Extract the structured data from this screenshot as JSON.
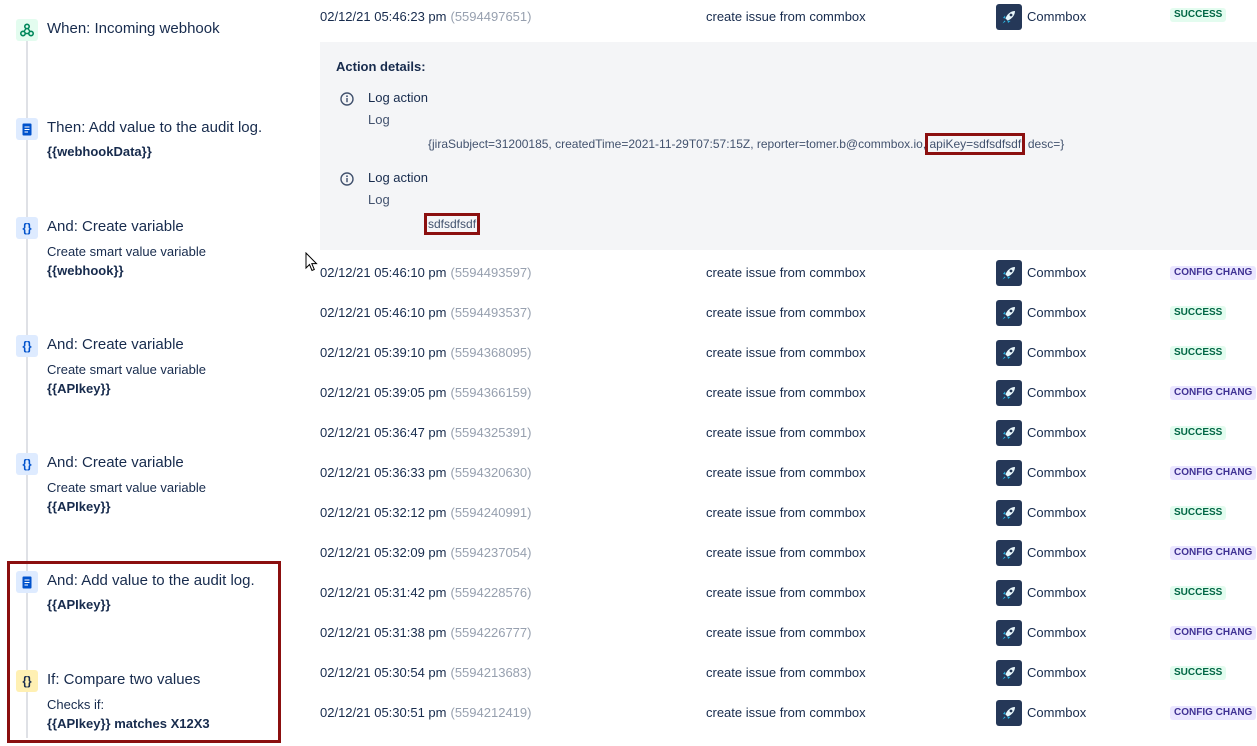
{
  "rule": {
    "steps": [
      {
        "kind": "trigger",
        "icon": "webhook-icon",
        "title": "When: Incoming webhook",
        "sub": "",
        "value": ""
      },
      {
        "kind": "action",
        "icon": "audit-log-icon",
        "title": "Then: Add value to the audit log.",
        "sub": "",
        "value": "{{webhookData}}"
      },
      {
        "kind": "action",
        "icon": "variable-icon",
        "title": "And: Create variable",
        "sub": "Create smart value variable",
        "value": "{{webhook}}"
      },
      {
        "kind": "action",
        "icon": "variable-icon",
        "title": "And: Create variable",
        "sub": "Create smart value variable",
        "value": "{{APIkey}}"
      },
      {
        "kind": "action",
        "icon": "variable-icon",
        "title": "And: Create variable",
        "sub": "Create smart value variable",
        "value": "{{APIkey}}"
      },
      {
        "kind": "action",
        "icon": "audit-log-icon",
        "title": "And: Add value to the audit log.",
        "sub": "",
        "value": "{{APIkey}}"
      },
      {
        "kind": "condition",
        "icon": "condition-icon",
        "title": "If: Compare two values",
        "sub": "Checks if:",
        "value": "{{APIkey}} matches X12X3"
      }
    ]
  },
  "audit": {
    "first_row": {
      "date": "02/12/21 05:46:23 pm",
      "id": "(5594497651)",
      "rule": "create issue from commbox",
      "actor": "Commbox",
      "status": "SUCCESS"
    },
    "details": {
      "heading": "Action details:",
      "entries": [
        {
          "action": "Log action",
          "type": "Log",
          "message_pre": "{jiraSubject=31200185, createdTime=2021-11-29T07:57:15Z, reporter=tomer.b@commbox.io, ",
          "message_hl": "apiKey=sdfsdfsdf",
          "message_post": ", desc=}"
        },
        {
          "action": "Log action",
          "type": "Log",
          "message_pre": "",
          "message_hl": "sdfsdfsdf",
          "message_post": ""
        }
      ]
    },
    "rows": [
      {
        "date": "02/12/21 05:46:10 pm",
        "id": "(5594493597)",
        "rule": "create issue from commbox",
        "actor": "Commbox",
        "status": "CONFIG CHANG",
        "kind": "config"
      },
      {
        "date": "02/12/21 05:46:10 pm",
        "id": "(5594493537)",
        "rule": "create issue from commbox",
        "actor": "Commbox",
        "status": "SUCCESS",
        "kind": "success"
      },
      {
        "date": "02/12/21 05:39:10 pm",
        "id": "(5594368095)",
        "rule": "create issue from commbox",
        "actor": "Commbox",
        "status": "SUCCESS",
        "kind": "success"
      },
      {
        "date": "02/12/21 05:39:05 pm",
        "id": "(5594366159)",
        "rule": "create issue from commbox",
        "actor": "Commbox",
        "status": "CONFIG CHANG",
        "kind": "config"
      },
      {
        "date": "02/12/21 05:36:47 pm",
        "id": "(5594325391)",
        "rule": "create issue from commbox",
        "actor": "Commbox",
        "status": "SUCCESS",
        "kind": "success"
      },
      {
        "date": "02/12/21 05:36:33 pm",
        "id": "(5594320630)",
        "rule": "create issue from commbox",
        "actor": "Commbox",
        "status": "CONFIG CHANG",
        "kind": "config"
      },
      {
        "date": "02/12/21 05:32:12 pm",
        "id": "(5594240991)",
        "rule": "create issue from commbox",
        "actor": "Commbox",
        "status": "SUCCESS",
        "kind": "success"
      },
      {
        "date": "02/12/21 05:32:09 pm",
        "id": "(5594237054)",
        "rule": "create issue from commbox",
        "actor": "Commbox",
        "status": "CONFIG CHANG",
        "kind": "config"
      },
      {
        "date": "02/12/21 05:31:42 pm",
        "id": "(5594228576)",
        "rule": "create issue from commbox",
        "actor": "Commbox",
        "status": "SUCCESS",
        "kind": "success"
      },
      {
        "date": "02/12/21 05:31:38 pm",
        "id": "(5594226777)",
        "rule": "create issue from commbox",
        "actor": "Commbox",
        "status": "CONFIG CHANG",
        "kind": "config"
      },
      {
        "date": "02/12/21 05:30:54 pm",
        "id": "(5594213683)",
        "rule": "create issue from commbox",
        "actor": "Commbox",
        "status": "SUCCESS",
        "kind": "success"
      },
      {
        "date": "02/12/21 05:30:51 pm",
        "id": "(5594212419)",
        "rule": "create issue from commbox",
        "actor": "Commbox",
        "status": "CONFIG CHANG",
        "kind": "config"
      }
    ]
  },
  "colors": {
    "highlight": "#8b0f0f",
    "success_bg": "#e3fcef",
    "config_bg": "#eae6ff",
    "details_bg": "#f4f5f7"
  }
}
